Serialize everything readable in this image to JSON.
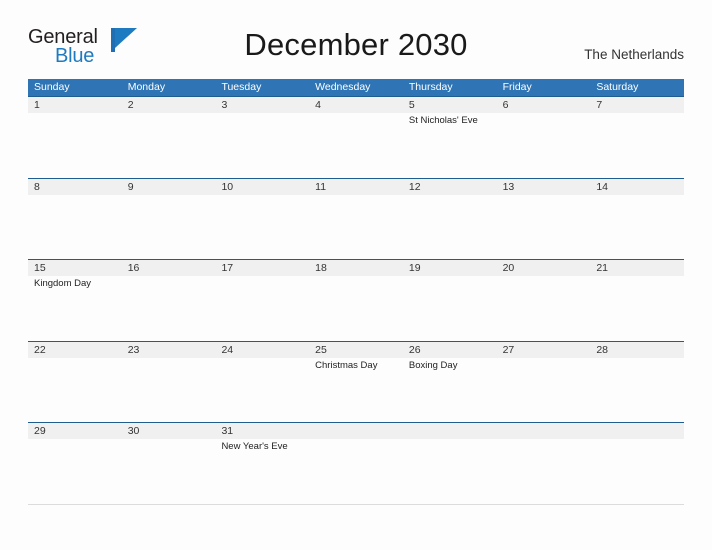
{
  "logo": {
    "word_general": "General",
    "word_blue": "Blue",
    "flag_icon": "triangle-flag-icon",
    "brand_blue": "#1f7bc1",
    "brand_dark": "#231f20"
  },
  "header": {
    "title": "December 2030",
    "region": "The Netherlands"
  },
  "colors": {
    "weekday_header_bg": "#2f75b5",
    "weekday_header_text": "#ffffff",
    "day_band_bg": "#f0f0f0",
    "row_top_border": "#1f5c8f",
    "page_bg": "#fdfdfd",
    "body_text": "#222222"
  },
  "calendar": {
    "month": "December",
    "year": "2030",
    "weekdays": [
      "Sunday",
      "Monday",
      "Tuesday",
      "Wednesday",
      "Thursday",
      "Friday",
      "Saturday"
    ],
    "weeks": [
      [
        {
          "day": "1",
          "events": []
        },
        {
          "day": "2",
          "events": []
        },
        {
          "day": "3",
          "events": []
        },
        {
          "day": "4",
          "events": []
        },
        {
          "day": "5",
          "events": [
            "St Nicholas' Eve"
          ]
        },
        {
          "day": "6",
          "events": []
        },
        {
          "day": "7",
          "events": []
        }
      ],
      [
        {
          "day": "8",
          "events": []
        },
        {
          "day": "9",
          "events": []
        },
        {
          "day": "10",
          "events": []
        },
        {
          "day": "11",
          "events": []
        },
        {
          "day": "12",
          "events": []
        },
        {
          "day": "13",
          "events": []
        },
        {
          "day": "14",
          "events": []
        }
      ],
      [
        {
          "day": "15",
          "events": [
            "Kingdom Day"
          ]
        },
        {
          "day": "16",
          "events": []
        },
        {
          "day": "17",
          "events": []
        },
        {
          "day": "18",
          "events": []
        },
        {
          "day": "19",
          "events": []
        },
        {
          "day": "20",
          "events": []
        },
        {
          "day": "21",
          "events": []
        }
      ],
      [
        {
          "day": "22",
          "events": []
        },
        {
          "day": "23",
          "events": []
        },
        {
          "day": "24",
          "events": []
        },
        {
          "day": "25",
          "events": [
            "Christmas Day"
          ]
        },
        {
          "day": "26",
          "events": [
            "Boxing Day"
          ]
        },
        {
          "day": "27",
          "events": []
        },
        {
          "day": "28",
          "events": []
        }
      ],
      [
        {
          "day": "29",
          "events": []
        },
        {
          "day": "30",
          "events": []
        },
        {
          "day": "31",
          "events": [
            "New Year's Eve"
          ]
        },
        {
          "day": "",
          "events": []
        },
        {
          "day": "",
          "events": []
        },
        {
          "day": "",
          "events": []
        },
        {
          "day": "",
          "events": []
        }
      ]
    ]
  }
}
